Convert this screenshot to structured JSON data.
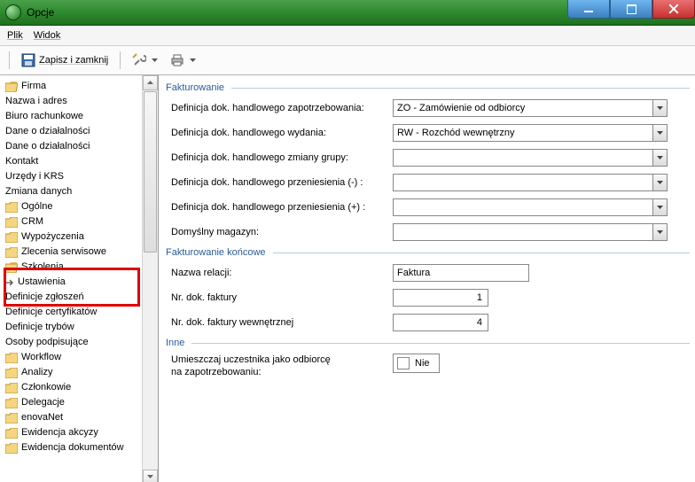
{
  "window": {
    "title": "Opcje"
  },
  "menu": {
    "file": "Plik",
    "view": "Widok"
  },
  "toolbar": {
    "save_close": "Zapisz i zamknij"
  },
  "tree": {
    "firma": "Firma",
    "firma_children": {
      "nazwa": "Nazwa i adres",
      "biuro": "Biuro rachunkowe",
      "dane1": "Dane o działalności",
      "dane2": "Dane o działalności",
      "kontakt": "Kontakt",
      "urzedy": "Urzędy i KRS",
      "zmiana": "Zmiana danych"
    },
    "ogolne": "Ogólne",
    "crm": "CRM",
    "wypozyczenia": "Wypożyczenia",
    "zlecenia": "Zlecenia serwisowe",
    "szkolenia": "Szkolenia",
    "szkolenia_children": {
      "ustawienia": "Ustawienia",
      "def_zgl": "Definicje zgłoszeń",
      "def_cert": "Definicje certyfikatów",
      "def_tryb": "Definicje trybów",
      "osoby": "Osoby podpisujące"
    },
    "workflow": "Workflow",
    "analizy": "Analizy",
    "czlonkowie": "Członkowie",
    "delegacje": "Delegacje",
    "enovanet": "enovaNet",
    "ewid_akcyzy": "Ewidencja akcyzy",
    "ewid_dok": "Ewidencja dokumentów"
  },
  "form": {
    "group_fakturowanie": "Fakturowanie",
    "def_zapotrz_label": "Definicja dok. handlowego zapotrzebowania:",
    "def_zapotrz_value": "ZO - Zamówienie od odbiorcy",
    "def_wydania_label": "Definicja dok. handlowego wydania:",
    "def_wydania_value": "RW - Rozchód wewnętrzny",
    "def_zmiany_label": "Definicja dok. handlowego zmiany grupy:",
    "def_zmiany_value": "",
    "def_przen_minus_label": "Definicja dok. handlowego przeniesienia (-) :",
    "def_przen_minus_value": "",
    "def_przen_plus_label": "Definicja dok. handlowego przeniesienia (+) :",
    "def_przen_plus_value": "",
    "magazyn_label": "Domyślny magazyn:",
    "magazyn_value": "",
    "group_koncowe": "Fakturowanie końcowe",
    "nazwa_relacji_label": "Nazwa relacji:",
    "nazwa_relacji_value": "Faktura",
    "nr_faktury_label": "Nr. dok. faktury",
    "nr_faktury_value": "1",
    "nr_faktury_wewn_label": "Nr. dok. faktury wewnętrznej",
    "nr_faktury_wewn_value": "4",
    "group_inne": "Inne",
    "umieszczaj_label_l1": "Umieszczaj uczestnika jako odbiorcę",
    "umieszczaj_label_l2": "na zapotrzebowaniu:",
    "umieszczaj_value": "Nie"
  }
}
